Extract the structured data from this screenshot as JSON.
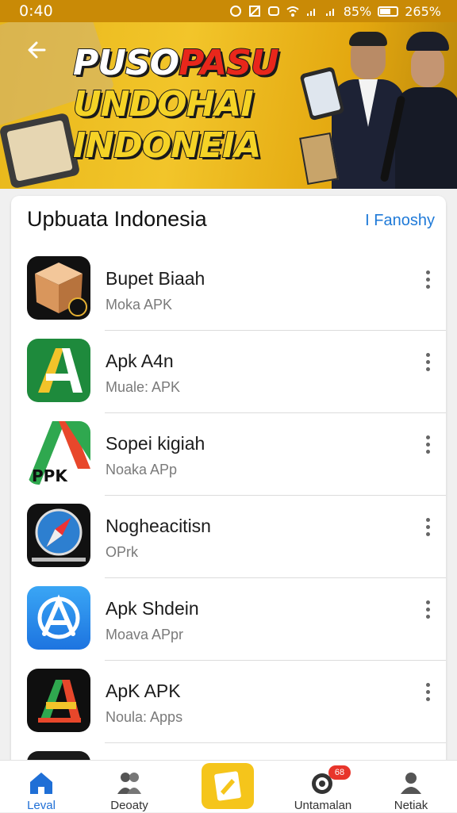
{
  "status_bar": {
    "time": "0:40",
    "battery": "85%",
    "extra": "265%"
  },
  "banner": {
    "title_line1_white": "PUSO",
    "title_line1_red": "PASU",
    "title_line2": "UNDOHAI",
    "title_line3": "INDONEIA"
  },
  "section": {
    "title": "Upbuata Indonesia",
    "link": "I Fanoshy"
  },
  "apps": [
    {
      "name": "Bupet Biaah",
      "subtitle": "Moka APK",
      "icon": "box-app-icon"
    },
    {
      "name": "Apk A4n",
      "subtitle": "Muale: APK",
      "icon": "letter-a-green-icon"
    },
    {
      "name": "Sopei kigiah",
      "subtitle": "Noaka APp",
      "icon": "ppk-triangle-icon"
    },
    {
      "name": "Nogheacitisn",
      "subtitle": "OPrk",
      "icon": "compass-icon"
    },
    {
      "name": "Apk Shdein",
      "subtitle": "Moava APpr",
      "icon": "app-store-a-icon"
    },
    {
      "name": "ApK APK",
      "subtitle": "Noula: Apps",
      "icon": "letter-a-dark-icon"
    }
  ],
  "nav": [
    {
      "label": "Leval",
      "icon": "home-icon",
      "active": true
    },
    {
      "label": "Deoaty",
      "icon": "people-icon",
      "active": false
    },
    {
      "label": "",
      "icon": "center-action-icon",
      "active": false
    },
    {
      "label": "Untamalan",
      "icon": "target-icon",
      "active": false,
      "badge": "68"
    },
    {
      "label": "Netiak",
      "icon": "profile-icon",
      "active": false
    }
  ],
  "colors": {
    "accent": "#1f6fd6",
    "banner": "#f2c52a",
    "badge": "#e8352b"
  }
}
